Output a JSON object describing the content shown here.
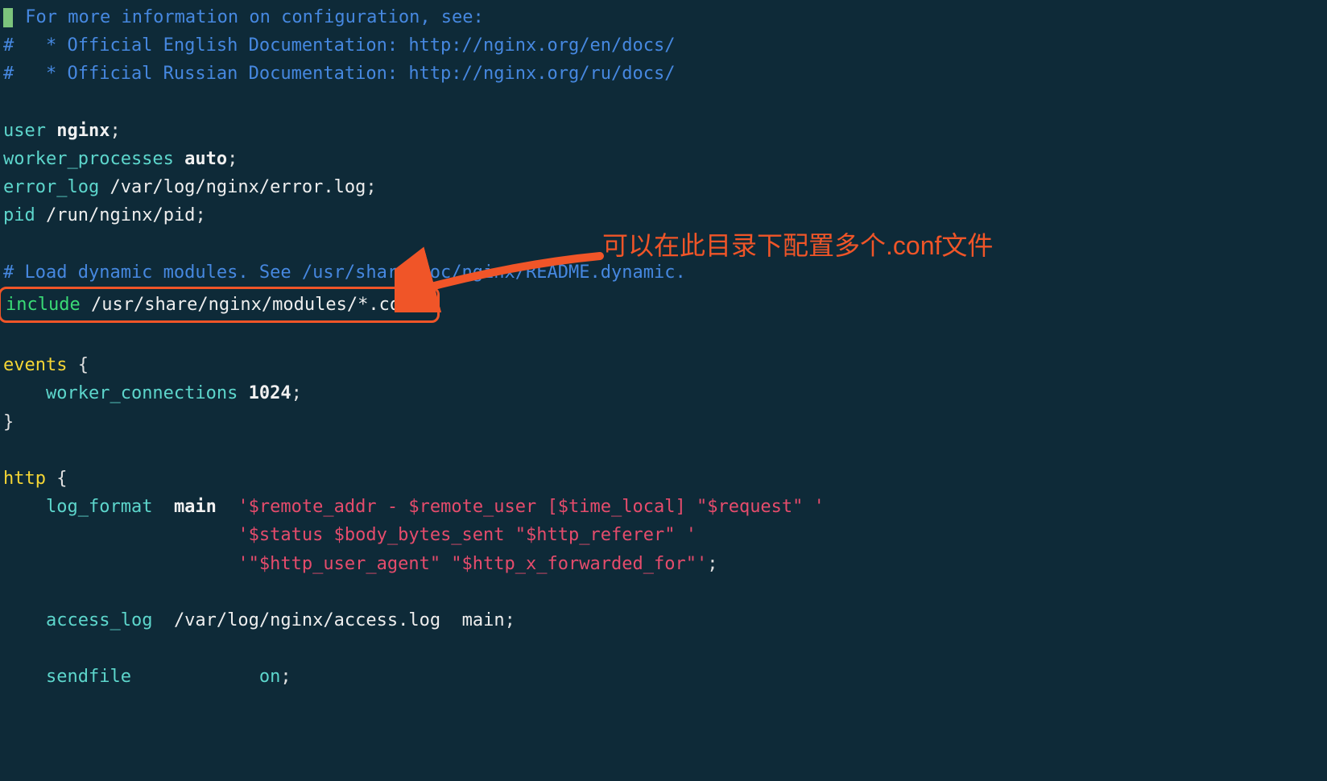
{
  "annotation": {
    "text": "可以在此目录下配置多个.conf文件"
  },
  "code": {
    "comment1": " For more information on configuration, see:",
    "comment2": "#   * Official English Documentation: http://nginx.org/en/docs/",
    "comment3": "#   * Official Russian Documentation: http://nginx.org/ru/docs/",
    "user_key": "user",
    "user_val": "nginx",
    "worker_proc_key": "worker_processes",
    "worker_proc_val": "auto",
    "error_log_key": "error_log",
    "error_log_val": "/var/log/nginx/error.log",
    "pid_key": "pid",
    "pid_val": "/run/nginx/pid",
    "comment4": "# Load dynamic modules. See /usr/share/doc/nginx/README.dynamic.",
    "include_key": "include",
    "include_val": "/usr/share/nginx/modules/*.conf",
    "events_key": "events",
    "worker_conn_key": "worker_connections",
    "worker_conn_val": "1024",
    "http_key": "http",
    "log_format_key": "log_format",
    "log_format_name": "main",
    "log_format_s1": "'$remote_addr - $remote_user [$time_local] \"$request\" '",
    "log_format_s2": "'$status $body_bytes_sent \"$http_referer\" '",
    "log_format_s3": "'\"$http_user_agent\" \"$http_x_forwarded_for\"'",
    "access_log_key": "access_log",
    "access_log_val": "/var/log/nginx/access.log",
    "access_log_fmt": "main",
    "sendfile_key": "sendfile",
    "sendfile_val": "on"
  }
}
